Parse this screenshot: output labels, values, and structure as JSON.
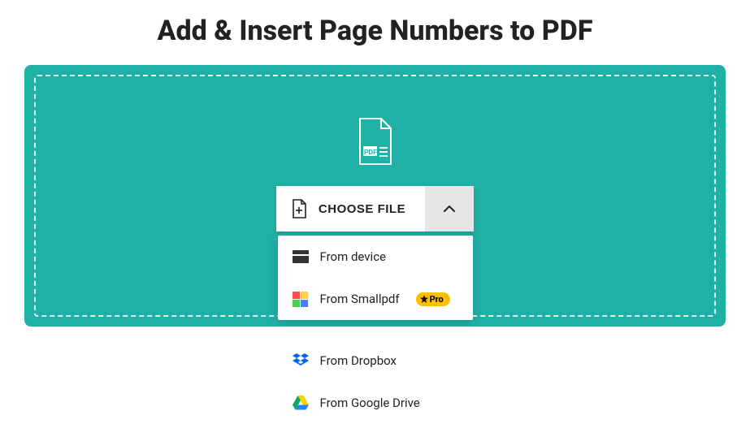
{
  "page_title": "Add & Insert Page Numbers to PDF",
  "upload_area": {
    "choose_file_label": "CHOOSE FILE"
  },
  "pro_badge": {
    "label": "Pro"
  },
  "source_menu": {
    "items": [
      {
        "label": "From device"
      },
      {
        "label": "From Smallpdf",
        "pro": true
      },
      {
        "label": "From Dropbox"
      },
      {
        "label": "From Google Drive"
      }
    ]
  }
}
